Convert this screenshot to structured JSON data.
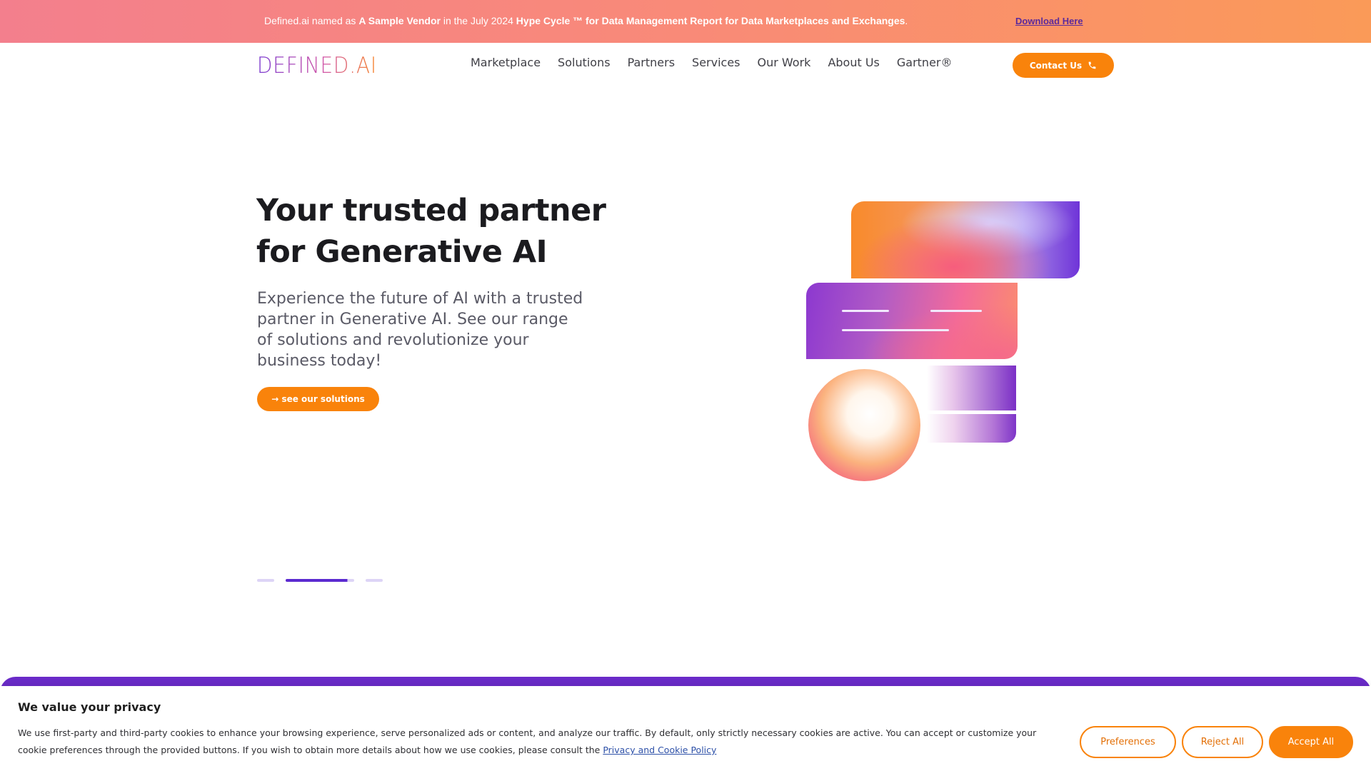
{
  "banner": {
    "prefix": "Defined.ai named as ",
    "vendor": "A Sample Vendor",
    "middle": " in the July 2024 ",
    "report": "Hype Cycle ™ for Data Management Report for Data Marketplaces and Exchanges",
    "suffix": ".",
    "link": "Download Here"
  },
  "logo": {
    "text": "DEFINED.AI"
  },
  "nav": {
    "items": [
      {
        "label": "Marketplace"
      },
      {
        "label": "Solutions"
      },
      {
        "label": "Partners"
      },
      {
        "label": "Services"
      },
      {
        "label": "Our Work"
      },
      {
        "label": "About Us"
      },
      {
        "label": "Gartner®"
      }
    ],
    "contact_label": "Contact Us"
  },
  "hero": {
    "title_line1": "Your trusted partner",
    "title_line2": "for Generative AI",
    "subtitle": "Experience the future of AI with a trusted partner in Generative AI. See our range of solutions and revolutionize your business today!",
    "cta_label": "→ see our solutions"
  },
  "slider": {
    "count": 3,
    "active_index": 1
  },
  "cookie": {
    "title": "We value your privacy",
    "text": "We use first-party and third-party cookies to enhance your browsing experience, serve personalized ads or content, and analyze our traffic. By default, only strictly necessary cookies are active. You can accept or customize your cookie preferences through the provided buttons. If you wish to obtain more details about how we use cookies, please consult the ",
    "link": "Privacy and Cookie Policy",
    "preferences_label": "Preferences",
    "reject_label": "Reject All",
    "accept_label": "Accept All"
  },
  "colors": {
    "accent": "#f9830b",
    "brand_purple": "#6a2bc8",
    "banner_start": "#f37f8d",
    "banner_end": "#fa9a58"
  },
  "icons": {
    "contact": "phone-icon",
    "cta": "arrow-right-icon"
  }
}
